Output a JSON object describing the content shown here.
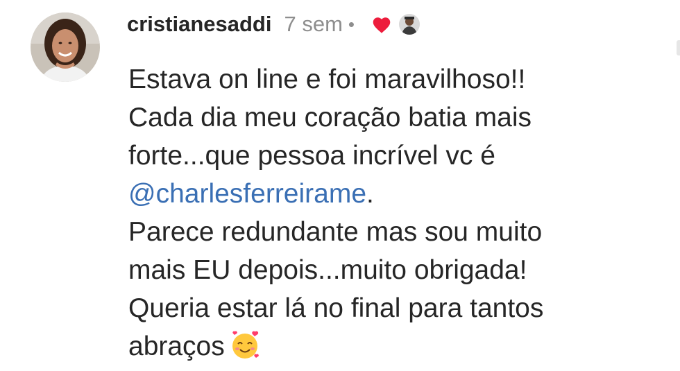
{
  "comment": {
    "author": {
      "username": "cristianesaddi",
      "avatar_icon": "user-avatar-photo"
    },
    "timestamp": "7 sem",
    "separator": "•",
    "like_icon": "heart-icon",
    "like_color": "#ed1c3c",
    "liked_by_icon": "liker-avatar-photo",
    "text": {
      "line1": "Estava on line e foi maravilhoso!!",
      "line2": "Cada dia meu coração batia mais",
      "line3": "forte...que pessoa incrível vc é",
      "mention": "@charlesferreirame",
      "line4_suffix": ".",
      "line5": "Parece redundante mas sou muito",
      "line6": "mais EU depois...muito obrigada!",
      "line7": "Queria estar lá no final para tantos",
      "line8": "abraços",
      "emoji_icon": "smiling-face-with-hearts-icon"
    },
    "mention_color": "#3a6fb4"
  }
}
